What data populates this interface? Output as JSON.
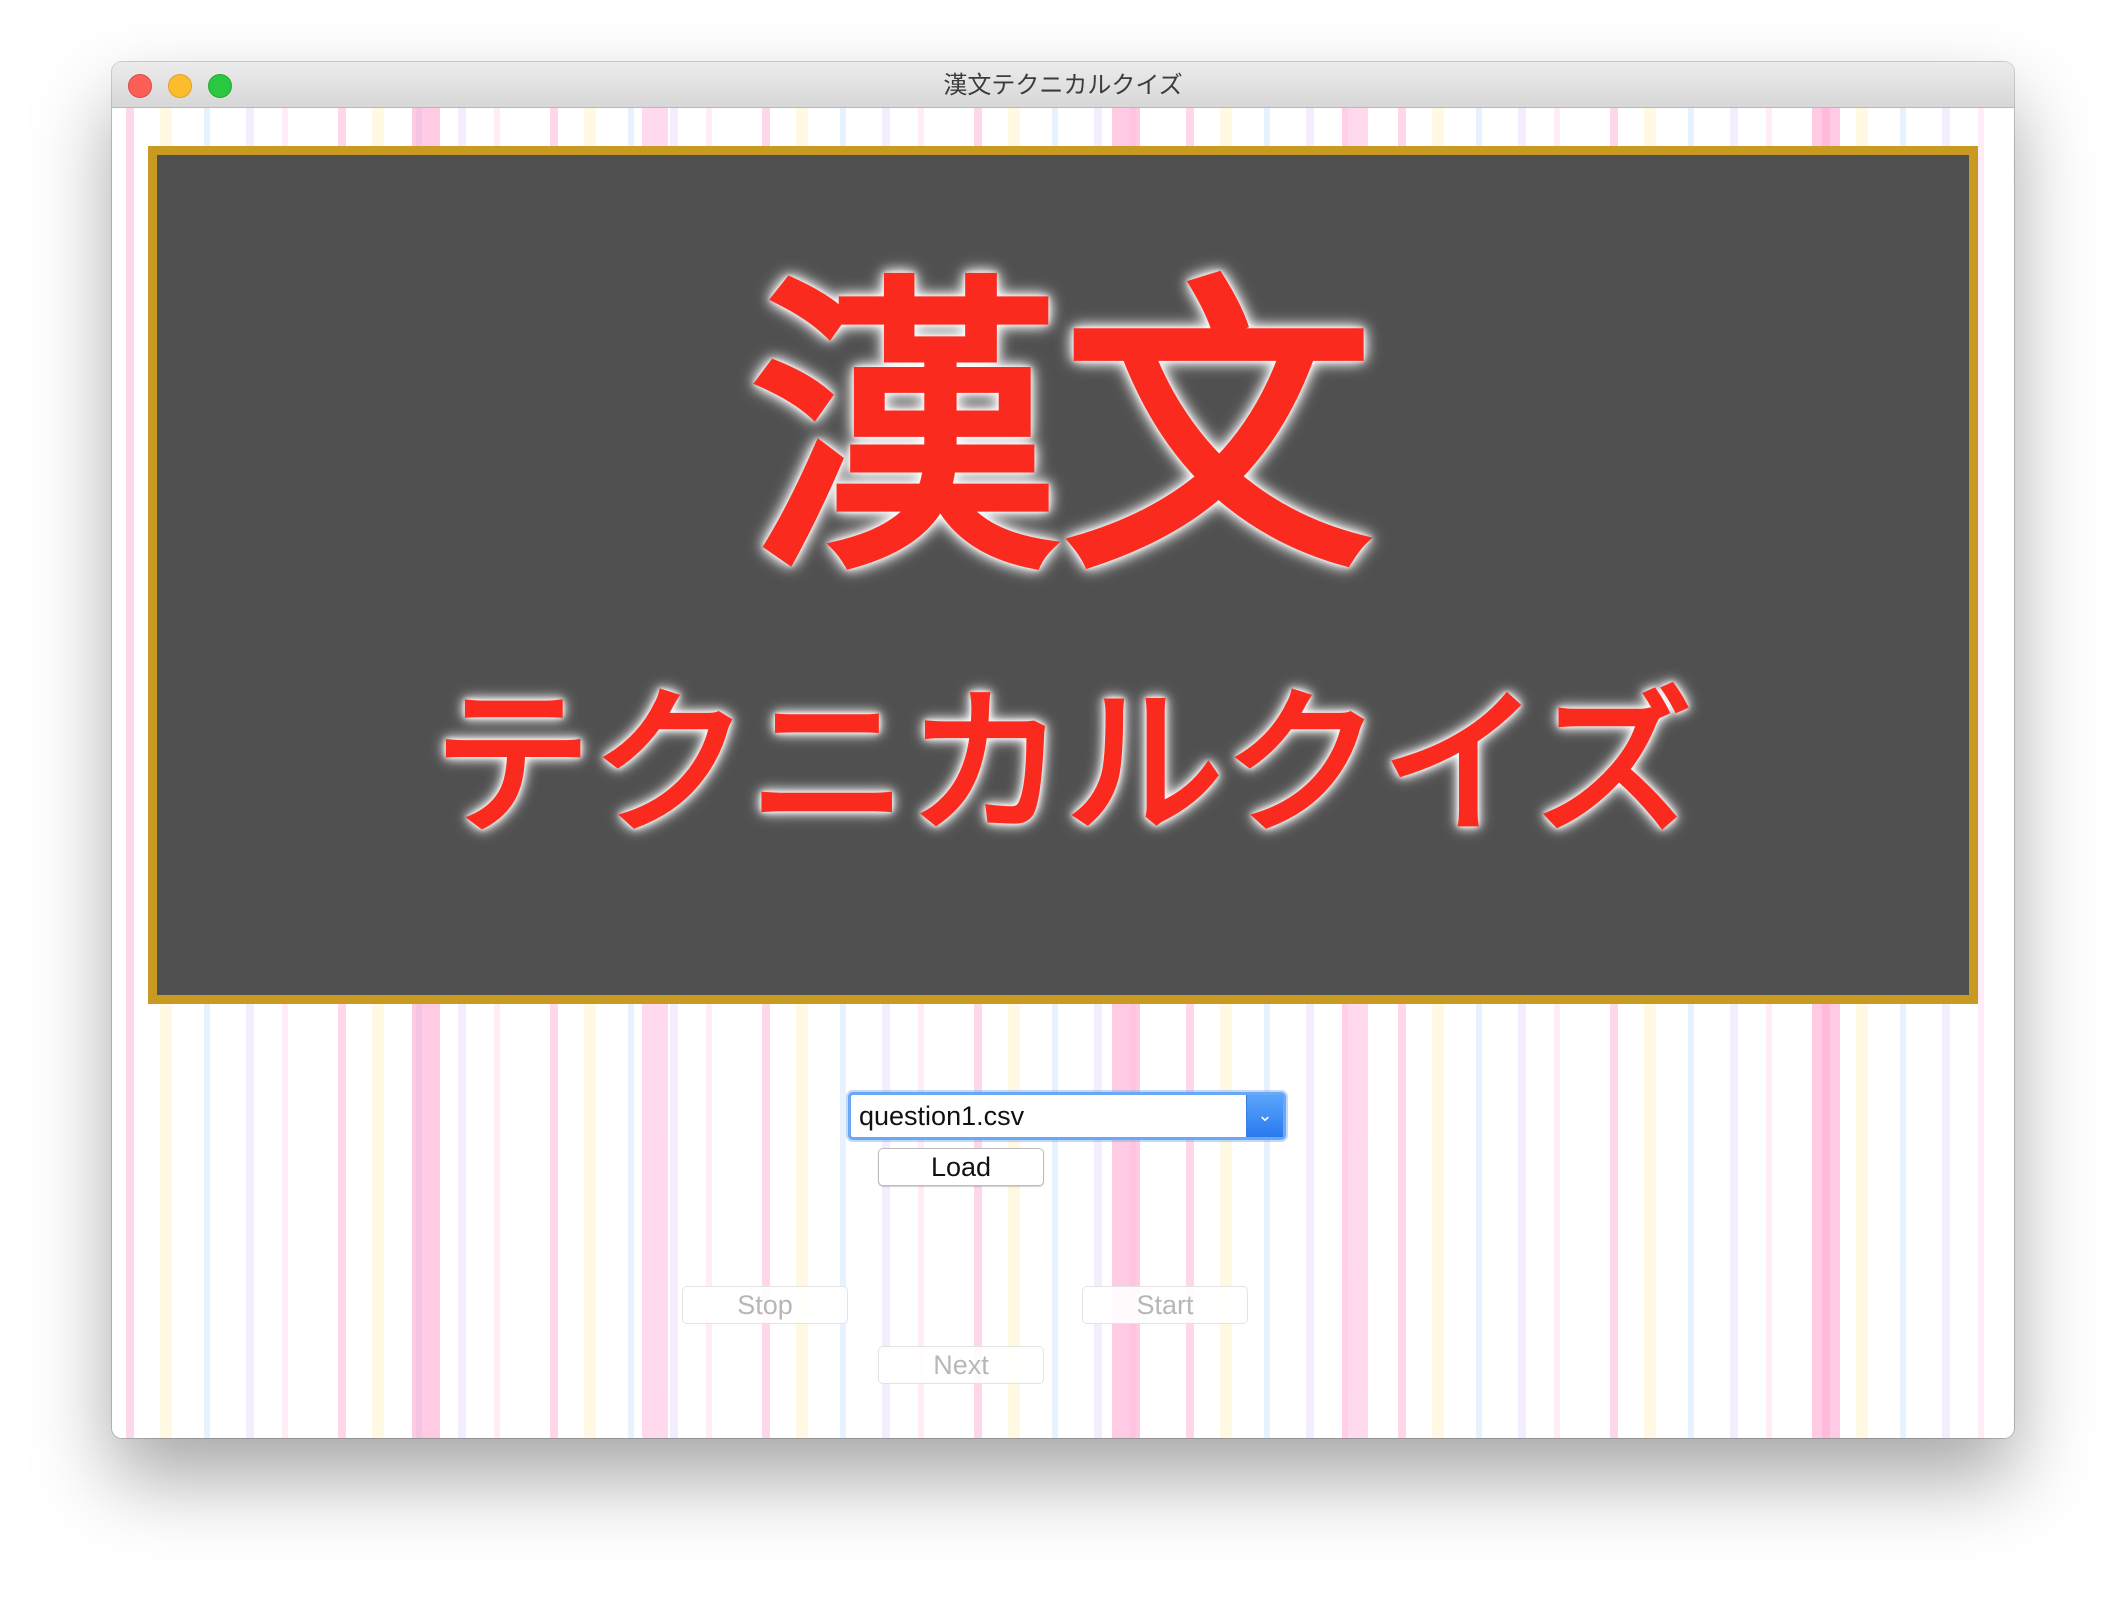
{
  "window": {
    "title": "漢文テクニカルクイズ"
  },
  "board": {
    "line1": "漢文",
    "line2": "テクニカルクイズ"
  },
  "file_select": {
    "value": "question1.csv"
  },
  "buttons": {
    "load": "Load",
    "stop": "Stop",
    "start": "Start",
    "next": "Next"
  },
  "colors": {
    "board_bg": "#505050",
    "board_border": "#c99a22",
    "title_text": "#fa2a1e"
  },
  "icons": {
    "select_arrow": "chevron-down-icon"
  }
}
